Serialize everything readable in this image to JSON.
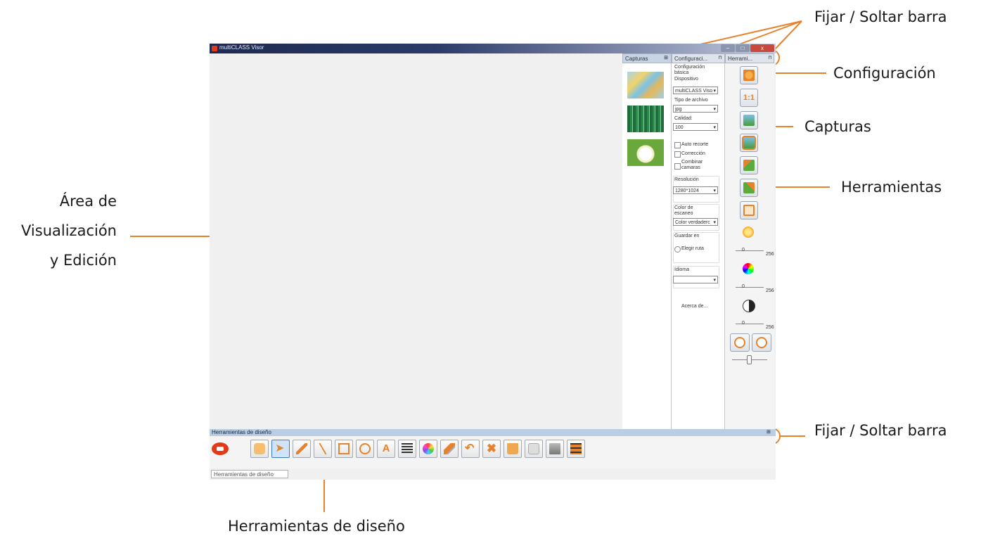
{
  "annotations": {
    "pin_top": "Fijar / Soltar barra",
    "configuracion": "Configuración",
    "capturas": "Capturas",
    "herramientas": "Herramientas",
    "area_line1": "Área de",
    "area_line2": "Visualización",
    "area_line3": "y Edición",
    "pin_bottom": "Fijar / Soltar barra",
    "herramientas_diseno": "Herramientas de diseño"
  },
  "window": {
    "title": "multiCLASS Visor",
    "controls": [
      "–",
      "□",
      "x"
    ]
  },
  "tabs": {
    "capturas": "Capturas",
    "configuracion": "Configuraci...",
    "herramientas": "Herrami..."
  },
  "config": {
    "basic_line1": "Configuración",
    "basic_line2": "básica",
    "device_label": "Dispositivo",
    "device_value": "multiCLASS Viso",
    "filetype_label": "Tipo de archivo",
    "filetype_value": "jpg",
    "quality_label": "Calidad:",
    "quality_value": "100",
    "auto_recorte": "Auto recorte",
    "correccion": "Corrección",
    "combinar_line1": "Combinar",
    "combinar_line2": "camaras",
    "resolucion_label": "Resolución",
    "resolucion_value": "1280*1024",
    "color_label_line1": "Color de",
    "color_label_line2": "escaneo",
    "color_value": "Color verdaderc",
    "guardar_label": "Guardar en",
    "elegir_ruta": "Elegir ruta",
    "idioma_label": "Idioma",
    "idioma_value": "",
    "acerca": "Acerca de..."
  },
  "tools_panel": {
    "one_to_one": "1:1",
    "slider_min": "0",
    "brightness_max": "256",
    "color_max": "256",
    "contrast_max": "256"
  },
  "bottom": {
    "bar_title": "Herramientas de diseño",
    "tab_label": "Herramientas de diseño"
  },
  "colors": {
    "accent_orange": "#e8822a",
    "titlebar": "#1e2a50",
    "dock_bar": "#b9cde3"
  }
}
